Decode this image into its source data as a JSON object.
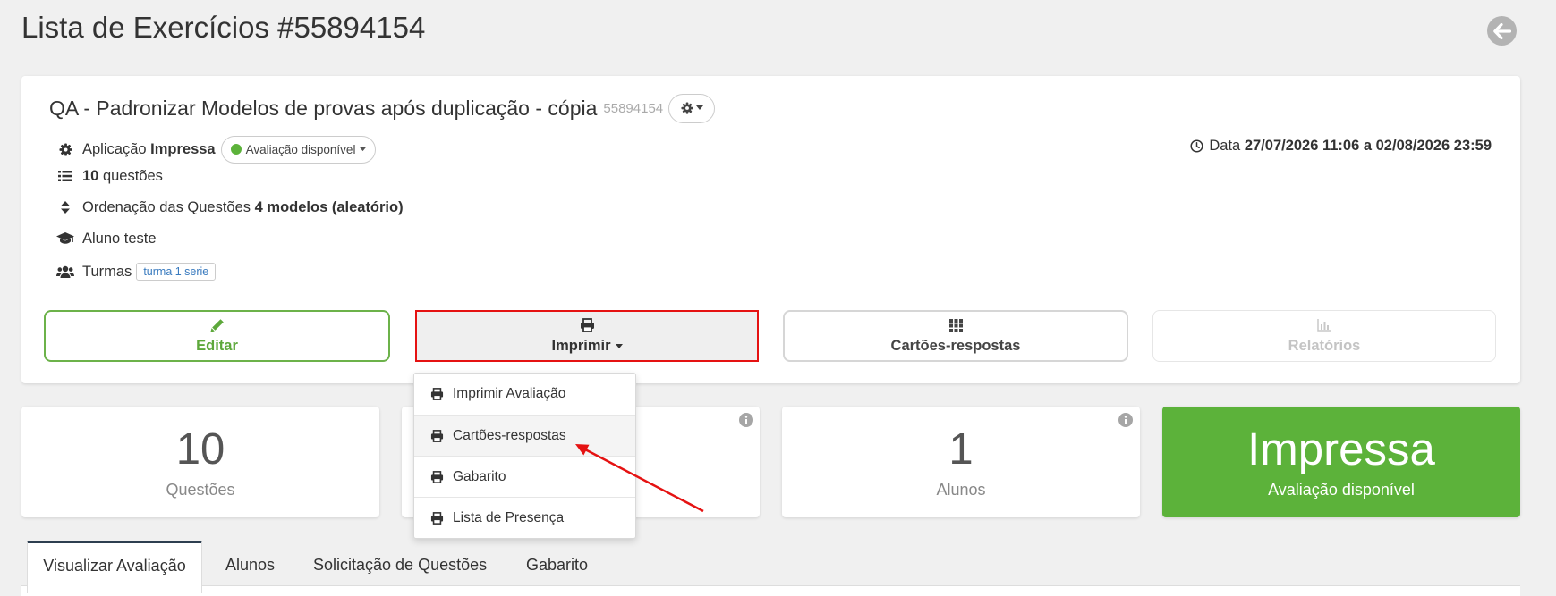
{
  "page": {
    "title": "Lista de Exercícios #55894154",
    "back_icon": "arrow-left-circle-icon"
  },
  "exam": {
    "title": "QA - Padronizar Modelos de provas após duplicação - cópia",
    "id": "55894154",
    "application_label": "Aplicação",
    "application_value": "Impressa",
    "status_badge": "Avaliação disponível",
    "questions_count": "10",
    "questions_label": "questões",
    "ordering_label": "Ordenação das Questões",
    "ordering_value": "4 modelos (aleatório)",
    "student": "Aluno teste",
    "classes_label": "Turmas",
    "class_badge": "turma 1 serie",
    "date_label": "Data",
    "date_value": "27/07/2026 11:06 a 02/08/2026 23:59"
  },
  "actions": {
    "edit": "Editar",
    "print": "Imprimir",
    "answer_sheets": "Cartões-respostas",
    "reports": "Relatórios"
  },
  "print_menu": {
    "items": [
      {
        "label": "Imprimir Avaliação",
        "icon": "printer-icon"
      },
      {
        "label": "Cartões-respostas",
        "icon": "printer-icon",
        "highlighted": true
      },
      {
        "label": "Gabarito",
        "icon": "printer-icon"
      },
      {
        "label": "Lista de Presença",
        "icon": "printer-icon"
      }
    ]
  },
  "stats": {
    "questions": {
      "value": "10",
      "label": "Questões"
    },
    "students": {
      "value": "1",
      "label": "Alunos"
    },
    "application": {
      "value": "Impressa",
      "label": "Avaliação disponível"
    }
  },
  "tabs": [
    {
      "label": "Visualizar Avaliação",
      "active": true
    },
    {
      "label": "Alunos"
    },
    {
      "label": "Solicitação de Questões"
    },
    {
      "label": "Gabarito"
    }
  ],
  "colors": {
    "accent_green": "#5cb23a",
    "edit_green": "#5da83b",
    "annotation_red": "#e51212",
    "class_badge_blue": "#3a7bbf",
    "page_background": "#f0f0f0"
  }
}
